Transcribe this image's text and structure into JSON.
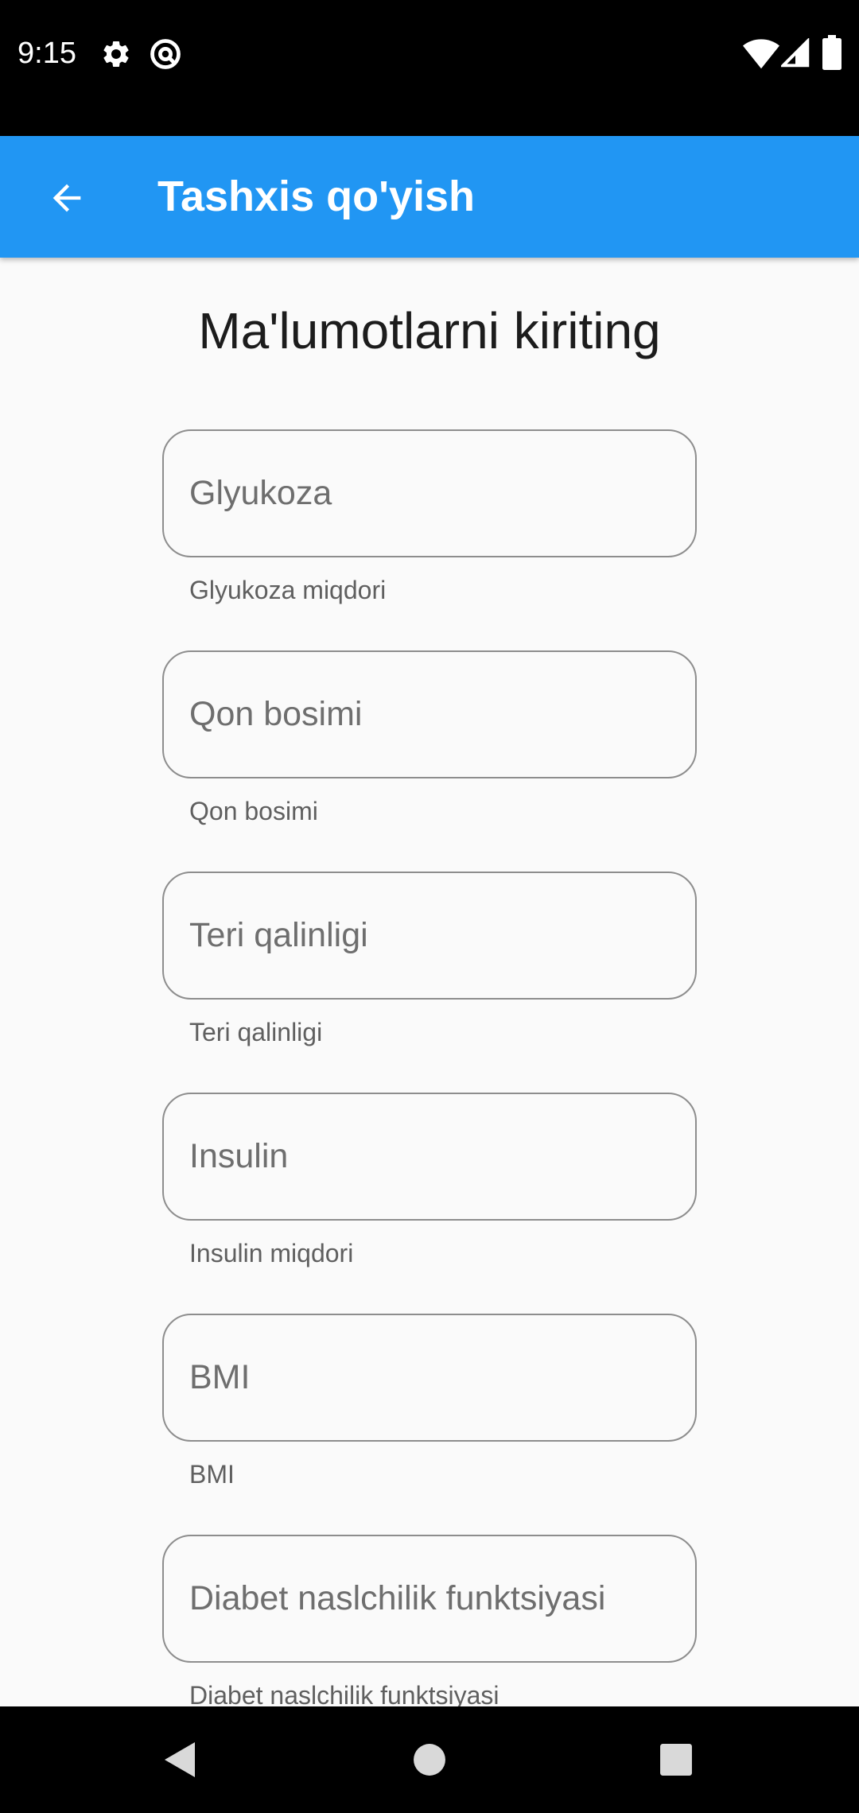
{
  "status_bar": {
    "time": "9:15",
    "left_icons": [
      "gear-icon",
      "at-sign-icon"
    ],
    "right_icons": [
      "wifi-icon",
      "signal-icon",
      "battery-icon"
    ]
  },
  "app_bar": {
    "title": "Tashxis qo'yish",
    "back_icon": "arrow-back-icon",
    "color": "#2196f3"
  },
  "page": {
    "heading": "Ma'lumotlarni kiriting"
  },
  "fields": [
    {
      "placeholder": "Glyukoza",
      "helper": "Glyukoza miqdori",
      "value": ""
    },
    {
      "placeholder": "Qon bosimi",
      "helper": "Qon bosimi",
      "value": ""
    },
    {
      "placeholder": "Teri qalinligi",
      "helper": "Teri qalinligi",
      "value": ""
    },
    {
      "placeholder": "Insulin",
      "helper": "Insulin miqdori",
      "value": ""
    },
    {
      "placeholder": "BMI",
      "helper": "BMI",
      "value": ""
    },
    {
      "placeholder": "Diabet naslchilik funktsiyasi",
      "helper": "Diabet naslchilik funktsiyasi",
      "value": ""
    }
  ],
  "nav_bar": {
    "buttons": [
      "back-triangle-icon",
      "home-circle-icon",
      "recents-square-icon"
    ]
  }
}
